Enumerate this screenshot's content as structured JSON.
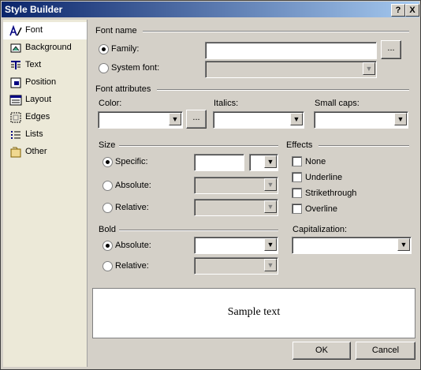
{
  "window": {
    "title": "Style Builder",
    "help_label": "?",
    "close_label": "X"
  },
  "sidebar": {
    "items": [
      {
        "label": "Font",
        "icon": "font-icon"
      },
      {
        "label": "Background",
        "icon": "background-icon"
      },
      {
        "label": "Text",
        "icon": "text-icon"
      },
      {
        "label": "Position",
        "icon": "position-icon"
      },
      {
        "label": "Layout",
        "icon": "layout-icon"
      },
      {
        "label": "Edges",
        "icon": "edges-icon"
      },
      {
        "label": "Lists",
        "icon": "lists-icon"
      },
      {
        "label": "Other",
        "icon": "other-icon"
      }
    ],
    "selected": "Font"
  },
  "font_name": {
    "heading": "Font name",
    "family_label": "Family:",
    "family_value": "",
    "browse_label": "...",
    "system_font_label": "System font:",
    "system_font_value": "",
    "selected": "Family"
  },
  "font_attributes": {
    "heading": "Font attributes",
    "color_label": "Color:",
    "color_value": "",
    "color_browse_label": "...",
    "italics_label": "Italics:",
    "italics_value": "",
    "small_caps_label": "Small caps:",
    "small_caps_value": ""
  },
  "size": {
    "heading": "Size",
    "specific_label": "Specific:",
    "absolute_label": "Absolute:",
    "relative_label": "Relative:",
    "specific_value": "",
    "unit_value": "",
    "selected": "Specific"
  },
  "effects": {
    "heading": "Effects",
    "none_label": "None",
    "underline_label": "Underline",
    "strikethrough_label": "Strikethrough",
    "overline_label": "Overline"
  },
  "bold": {
    "heading": "Bold",
    "absolute_label": "Absolute:",
    "relative_label": "Relative:",
    "absolute_value": "",
    "selected": "Absolute"
  },
  "capitalization": {
    "label": "Capitalization:",
    "value": ""
  },
  "preview": {
    "text": "Sample text"
  },
  "buttons": {
    "ok_label": "OK",
    "cancel_label": "Cancel"
  },
  "colors": {
    "title_gradient_start": "#0a246a",
    "title_gradient_end": "#a6caf0",
    "face": "#d4d0c8"
  }
}
